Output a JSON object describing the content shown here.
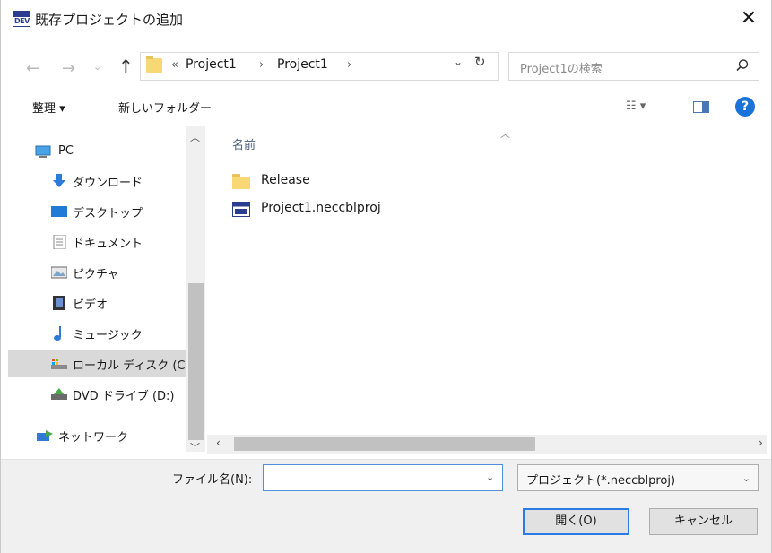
{
  "window": {
    "title": "既存プロジェクトの追加",
    "icon_text": "DEV",
    "close_glyph": "✕"
  },
  "address": {
    "overflow": "«",
    "crumbs": [
      "Project1",
      "Project1"
    ],
    "separator": "›",
    "search_placeholder": "Project1の検索"
  },
  "toolbar": {
    "organize_label": "整理 ▾",
    "new_folder_label": "新しいフォルダー",
    "view_glyph": "☷ ▾",
    "help_glyph": "?"
  },
  "navpane": {
    "items": [
      {
        "label": "PC",
        "icon": "pc-icon"
      },
      {
        "label": "ダウンロード",
        "icon": "download-icon"
      },
      {
        "label": "デスクトップ",
        "icon": "desktop-icon"
      },
      {
        "label": "ドキュメント",
        "icon": "document-icon"
      },
      {
        "label": "ピクチャ",
        "icon": "picture-icon"
      },
      {
        "label": "ビデオ",
        "icon": "video-icon"
      },
      {
        "label": "ミュージック",
        "icon": "music-icon"
      },
      {
        "label": "ローカル ディスク (C",
        "icon": "local-disk-icon"
      },
      {
        "label": "DVD ドライブ (D:)",
        "icon": "dvd-drive-icon"
      },
      {
        "label": "ネットワーク",
        "icon": "network-icon"
      }
    ],
    "selected_index": 7
  },
  "filelist": {
    "column_header": "名前",
    "files": [
      {
        "name": "Release",
        "icon": "folder-icon"
      },
      {
        "name": "Project1.neccblproj",
        "icon": "dev-project-icon"
      }
    ]
  },
  "footer": {
    "filename_label": "ファイル名(N):",
    "filename_value": "",
    "filter_value": "プロジェクト(*.neccblproj)",
    "open_label": "開く(O)",
    "cancel_label": "キャンセル"
  },
  "colors": {
    "accent": "#2c7be5",
    "folder": "#f8d775",
    "selection": "#d9d9d9",
    "footer_bg": "#f0f0f0"
  }
}
